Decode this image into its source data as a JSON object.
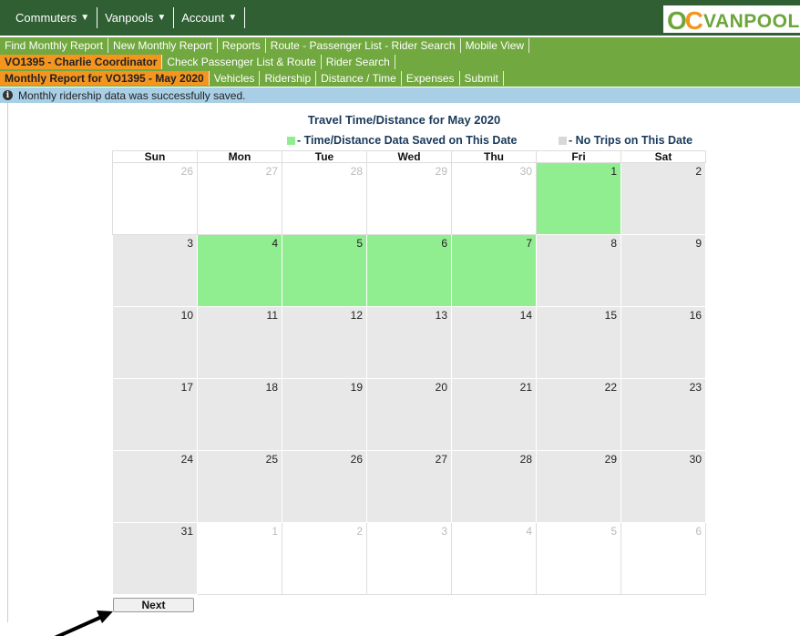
{
  "topmenu": [
    {
      "label": "Commuters"
    },
    {
      "label": "Vanpools"
    },
    {
      "label": "Account"
    }
  ],
  "logo": {
    "oc": "OC",
    "van": "VANPOOL"
  },
  "nav_row1": [
    "Find Monthly Report",
    "New Monthly Report",
    "Reports",
    "Route - Passenger List - Rider Search",
    "Mobile View"
  ],
  "nav_row2": [
    "VO1395 - Charlie Coordinator",
    "Check Passenger List & Route",
    "Rider Search"
  ],
  "nav_row3": [
    "Monthly Report for VO1395 - May 2020",
    "Vehicles",
    "Ridership",
    "Distance / Time",
    "Expenses",
    "Submit"
  ],
  "info": {
    "icon": "info-icon",
    "message": "Monthly ridership data was successfully saved."
  },
  "calendar": {
    "title": "Travel Time/Distance for May 2020",
    "legend_saved": "- Time/Distance Data Saved on This Date",
    "legend_notrip": "- No Trips on This Date",
    "days": [
      "Sun",
      "Mon",
      "Tue",
      "Wed",
      "Thu",
      "Fri",
      "Sat"
    ],
    "weeks": [
      [
        {
          "d": "26",
          "s": "other"
        },
        {
          "d": "27",
          "s": "other"
        },
        {
          "d": "28",
          "s": "other"
        },
        {
          "d": "29",
          "s": "other"
        },
        {
          "d": "30",
          "s": "other"
        },
        {
          "d": "1",
          "s": "saved"
        },
        {
          "d": "2",
          "s": "notrip"
        }
      ],
      [
        {
          "d": "3",
          "s": "notrip"
        },
        {
          "d": "4",
          "s": "saved"
        },
        {
          "d": "5",
          "s": "saved"
        },
        {
          "d": "6",
          "s": "saved"
        },
        {
          "d": "7",
          "s": "saved"
        },
        {
          "d": "8",
          "s": "notrip"
        },
        {
          "d": "9",
          "s": "notrip"
        }
      ],
      [
        {
          "d": "10",
          "s": "notrip"
        },
        {
          "d": "11",
          "s": "notrip"
        },
        {
          "d": "12",
          "s": "notrip"
        },
        {
          "d": "13",
          "s": "notrip"
        },
        {
          "d": "14",
          "s": "notrip"
        },
        {
          "d": "15",
          "s": "notrip"
        },
        {
          "d": "16",
          "s": "notrip"
        }
      ],
      [
        {
          "d": "17",
          "s": "notrip"
        },
        {
          "d": "18",
          "s": "notrip"
        },
        {
          "d": "19",
          "s": "notrip"
        },
        {
          "d": "20",
          "s": "notrip"
        },
        {
          "d": "21",
          "s": "notrip"
        },
        {
          "d": "22",
          "s": "notrip"
        },
        {
          "d": "23",
          "s": "notrip"
        }
      ],
      [
        {
          "d": "24",
          "s": "notrip"
        },
        {
          "d": "25",
          "s": "notrip"
        },
        {
          "d": "26",
          "s": "notrip"
        },
        {
          "d": "27",
          "s": "notrip"
        },
        {
          "d": "28",
          "s": "notrip"
        },
        {
          "d": "29",
          "s": "notrip"
        },
        {
          "d": "30",
          "s": "notrip"
        }
      ],
      [
        {
          "d": "31",
          "s": "notrip"
        },
        {
          "d": "1",
          "s": "other"
        },
        {
          "d": "2",
          "s": "other"
        },
        {
          "d": "3",
          "s": "other"
        },
        {
          "d": "4",
          "s": "other"
        },
        {
          "d": "5",
          "s": "other"
        },
        {
          "d": "6",
          "s": "other"
        }
      ]
    ]
  },
  "next_button": "Next",
  "colors": {
    "topbar": "#2f5f33",
    "nav": "#71a83f",
    "active": "#f4951f",
    "info": "#a9cfe6",
    "saved": "#90ee90",
    "notrip": "#e8e8e8"
  }
}
